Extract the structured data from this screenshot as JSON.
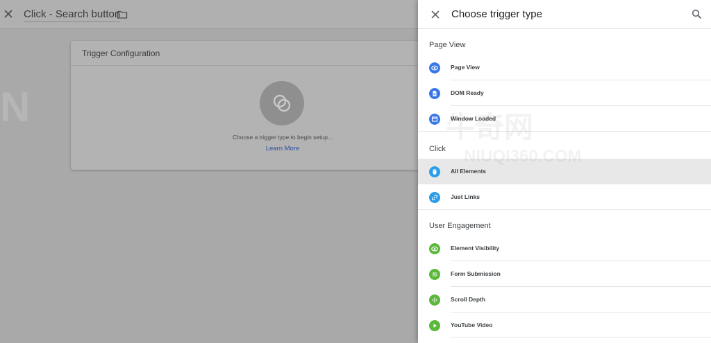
{
  "editor": {
    "title": "Click - Search button",
    "card": {
      "header": "Trigger Configuration",
      "hint": "Choose a trigger type to begin setup...",
      "learn_more": "Learn More"
    }
  },
  "watermark": {
    "brand": "牛奇网",
    "site": "NIUQI360.COM"
  },
  "panel": {
    "title": "Choose trigger type",
    "sections": [
      {
        "title": "Page View",
        "items": [
          {
            "label": "Page View",
            "icon": "eye-icon",
            "color": "#3b78e7"
          },
          {
            "label": "DOM Ready",
            "icon": "document-icon",
            "color": "#3b78e7"
          },
          {
            "label": "Window Loaded",
            "icon": "window-icon",
            "color": "#3b78e7"
          }
        ]
      },
      {
        "title": "Click",
        "items": [
          {
            "label": "All Elements",
            "icon": "mouse-icon",
            "color": "#2e9de8",
            "selected": true
          },
          {
            "label": "Just Links",
            "icon": "link-icon",
            "color": "#2e9de8"
          }
        ]
      },
      {
        "title": "User Engagement",
        "items": [
          {
            "label": "Element Visibility",
            "icon": "eye-icon",
            "color": "#5cb83c"
          },
          {
            "label": "Form Submission",
            "icon": "form-icon",
            "color": "#5cb83c"
          },
          {
            "label": "Scroll Depth",
            "icon": "scroll-icon",
            "color": "#5cb83c"
          },
          {
            "label": "YouTube Video",
            "icon": "play-icon",
            "color": "#5cb83c"
          }
        ]
      }
    ]
  }
}
